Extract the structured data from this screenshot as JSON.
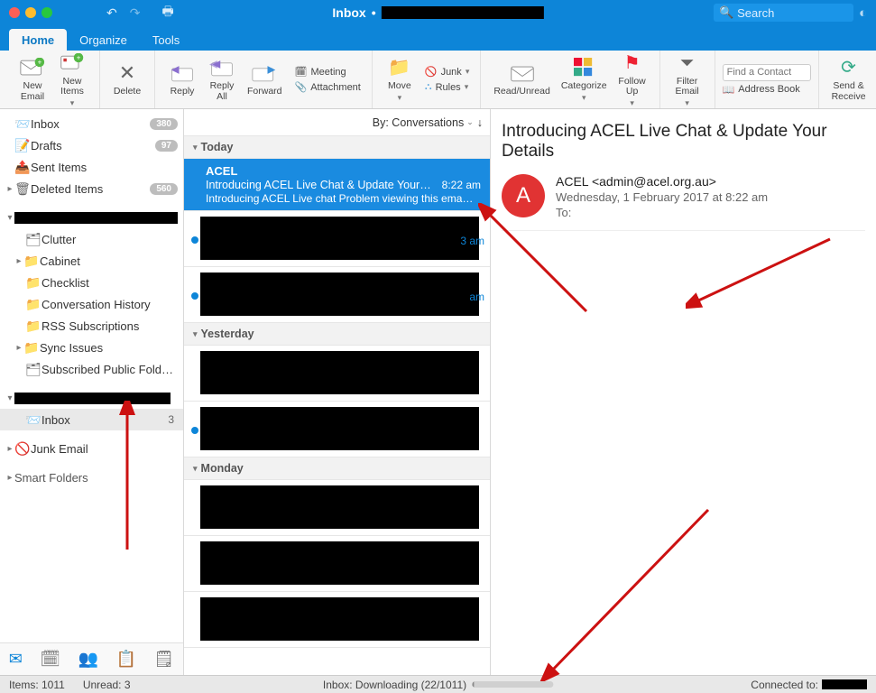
{
  "title": {
    "label": "Inbox"
  },
  "search": {
    "placeholder": "Search"
  },
  "tabs": {
    "home": "Home",
    "organize": "Organize",
    "tools": "Tools"
  },
  "ribbon": {
    "newEmail": "New\nEmail",
    "newItems": "New\nItems",
    "delete": "Delete",
    "reply": "Reply",
    "replyAll": "Reply\nAll",
    "forward": "Forward",
    "meeting": "Meeting",
    "attachment": "Attachment",
    "move": "Move",
    "junk": "Junk",
    "rules": "Rules",
    "readUnread": "Read/Unread",
    "categorize": "Categorize",
    "followUp": "Follow\nUp",
    "filterEmail": "Filter\nEmail",
    "findContactPH": "Find a Contact",
    "addressBook": "Address Book",
    "sendReceive": "Send &\nReceive"
  },
  "sidebar": {
    "inbox": "Inbox",
    "inboxCount": "380",
    "drafts": "Drafts",
    "draftsCount": "97",
    "sent": "Sent Items",
    "deleted": "Deleted Items",
    "deletedCount": "560",
    "clutter": "Clutter",
    "cabinet": "Cabinet",
    "checklist": "Checklist",
    "convHistory": "Conversation History",
    "rss": "RSS Subscriptions",
    "sync": "Sync Issues",
    "subPublic": "Subscribed Public Folders",
    "inbox2": "Inbox",
    "inbox2Count": "3",
    "junk": "Junk Email",
    "smart": "Smart Folders"
  },
  "sort": {
    "label": "By: Conversations"
  },
  "groups": {
    "today": "Today",
    "yesterday": "Yesterday",
    "monday": "Monday"
  },
  "selectedMsg": {
    "from": "ACEL",
    "subject": "Introducing ACEL Live Chat & Update Your…",
    "preview": "Introducing ACEL Live chat Problem viewing this ema…",
    "time": "8:22 am"
  },
  "msgTimes": {
    "r1": "3 am",
    "r2": "am"
  },
  "reading": {
    "title": "Introducing ACEL Live Chat & Update Your Details",
    "avatar": "A",
    "from": "ACEL <admin@acel.org.au>",
    "date": "Wednesday, 1 February 2017 at 8:22 am",
    "toLabel": "To:"
  },
  "status": {
    "items": "Items: 1011",
    "unread": "Unread: 3",
    "downloading": "Inbox: Downloading (22/1011)",
    "connected": "Connected to:"
  }
}
